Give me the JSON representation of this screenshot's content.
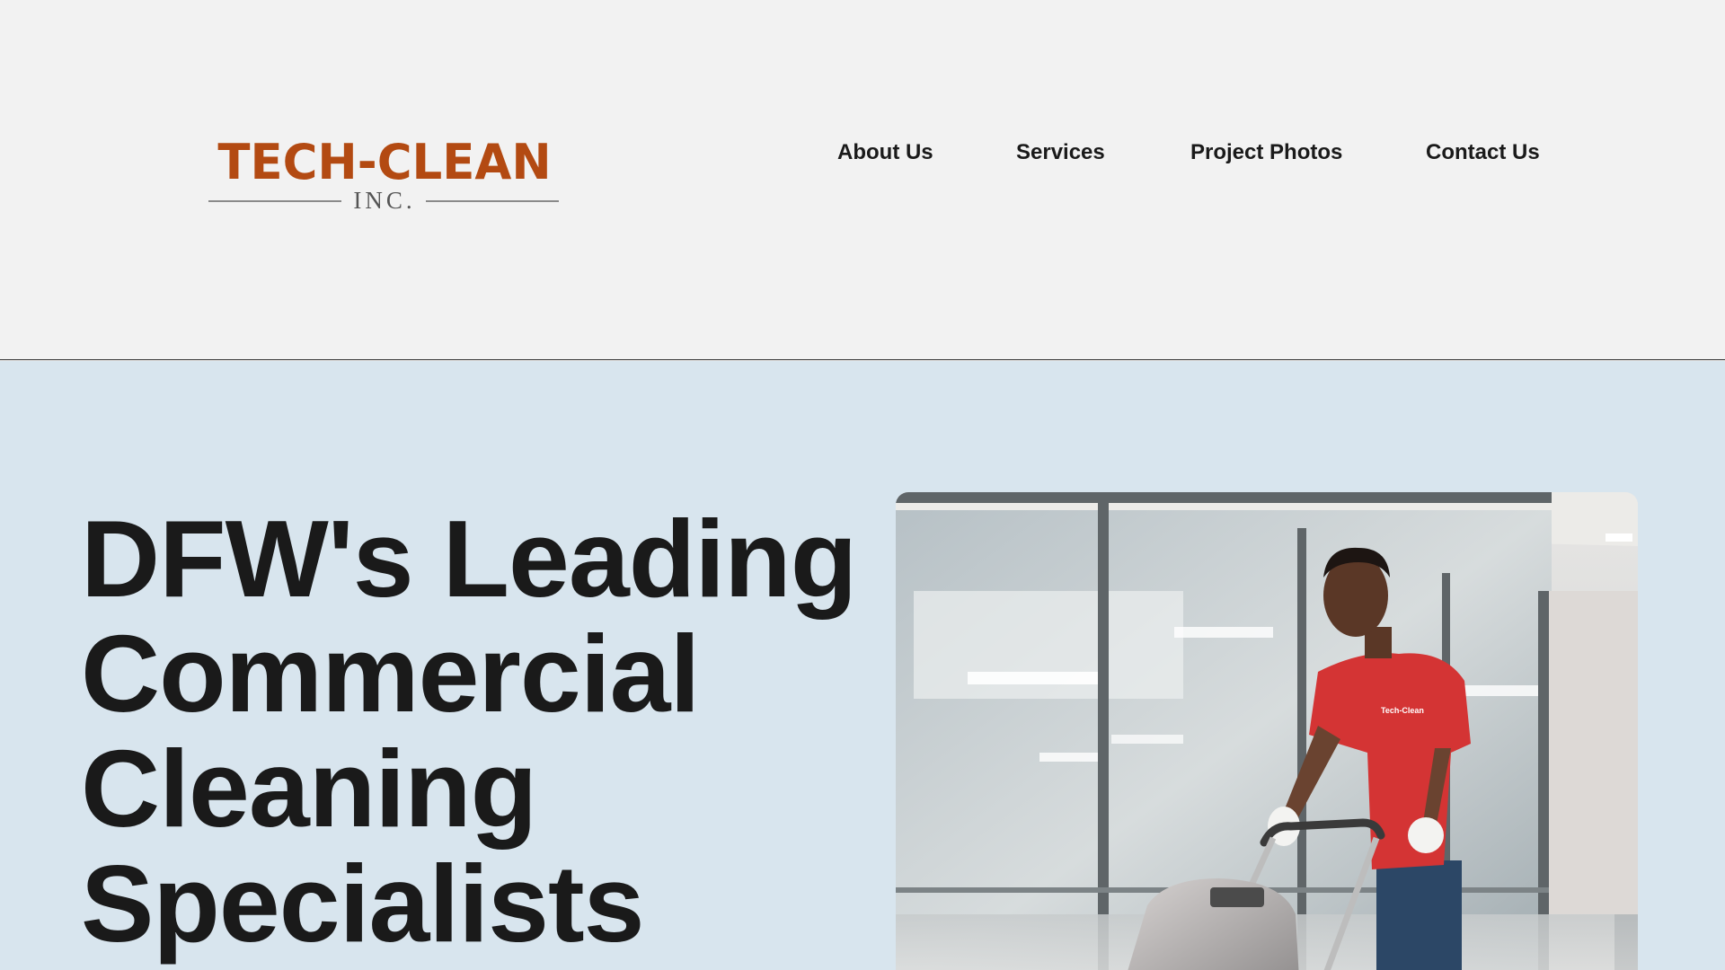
{
  "header": {
    "logo": {
      "name": "TECH-CLEAN",
      "suffix": "INC."
    },
    "nav": [
      {
        "label": "About Us"
      },
      {
        "label": "Services"
      },
      {
        "label": "Project Photos"
      },
      {
        "label": "Contact Us"
      }
    ]
  },
  "hero": {
    "title_lines": [
      "DFW's Leading",
      "Commercial",
      "Cleaning",
      "Specialists"
    ],
    "photo": {
      "shirt_text": "Tech-Clean"
    }
  },
  "colors": {
    "brand": "#b34a12",
    "header_bg": "#f2f2f2",
    "hero_bg": "#d8e5ee",
    "text": "#1a1a1a",
    "shirt": "#d43434"
  }
}
